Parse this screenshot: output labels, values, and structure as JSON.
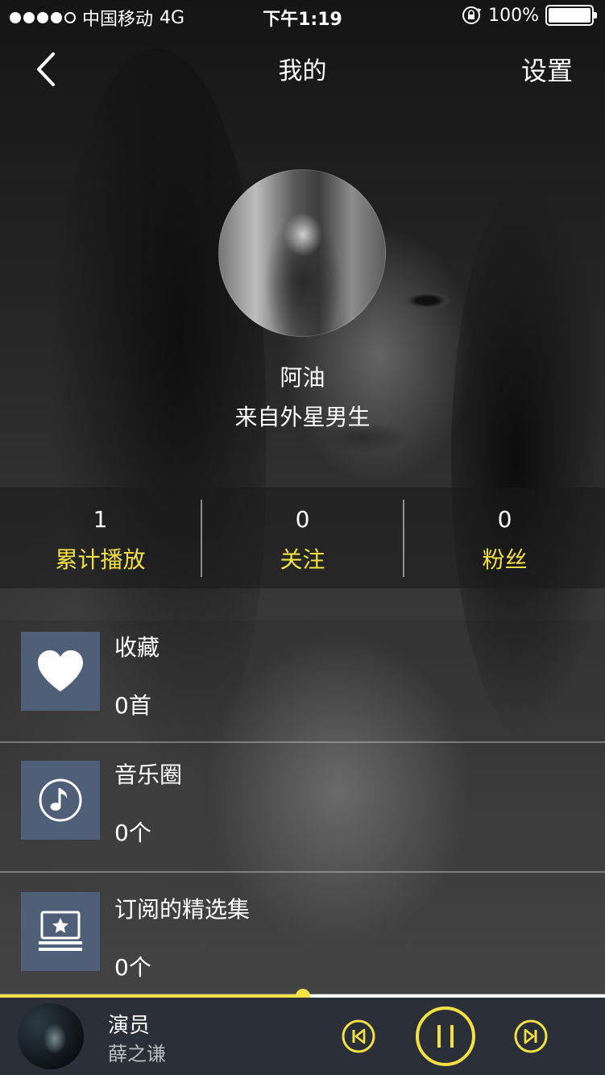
{
  "status_bar": {
    "carrier": "中国移动",
    "network": "4G",
    "time": "下午1:19",
    "battery": "100%"
  },
  "nav": {
    "title": "我的",
    "settings_label": "设置"
  },
  "profile": {
    "name": "阿油",
    "bio": "来自外星男生"
  },
  "stats": [
    {
      "value": "1",
      "label": "累计播放"
    },
    {
      "value": "0",
      "label": "关注"
    },
    {
      "value": "0",
      "label": "粉丝"
    }
  ],
  "list": [
    {
      "icon": "heart-icon",
      "title": "收藏",
      "count": "0首"
    },
    {
      "icon": "music-note-icon",
      "title": "音乐圈",
      "count": "0个"
    },
    {
      "icon": "star-collection-icon",
      "title": "订阅的精选集",
      "count": "0个"
    }
  ],
  "player": {
    "song": "演员",
    "artist": "薛之谦",
    "progress": 0.5,
    "state": "playing"
  },
  "colors": {
    "accent": "#f3e045",
    "list_icon_bg": "#4e5f77",
    "player_bg": "#2b3038"
  }
}
